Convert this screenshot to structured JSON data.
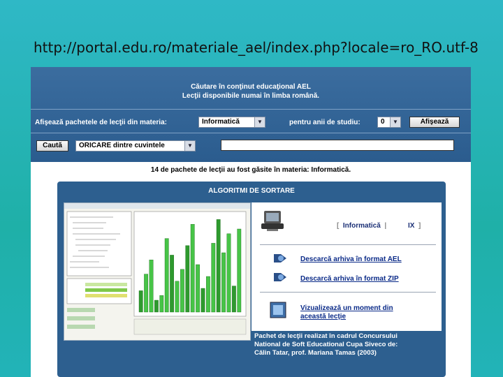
{
  "slide_url": "http://portal.edu.ro/materiale_ael/index.php?locale=ro_RO.utf-8",
  "search": {
    "title_line1": "Căutare în conţinut educaţional AEL",
    "title_line2": "Lecţii disponibile numai în limba română.",
    "subject_label": "Afişează pachetele de lecţii din materia:",
    "subject_value": "Informatică",
    "year_label": "pentru anii de studiu:",
    "year_value": "0",
    "show_button": "Afişează",
    "search_button": "Caută",
    "mode_value": "ORICARE dintre cuvintele",
    "query_value": ""
  },
  "results_text": "14 de pachete de lecţii au fost găsite în materia: Informatică.",
  "package": {
    "title": "ALGORITMI DE SORTARE",
    "subject": "Informatică",
    "grade": "IX",
    "link_ael": "Descarcă arhiva în format AEL",
    "link_zip": "Descarcă arhiva în format ZIP",
    "link_view_line1": "Vizualizează un moment din",
    "link_view_line2": "această lecţie",
    "description_line1": "Pachet de lecţii realizat în cadrul Concursului",
    "description_line2": "National de Soft Educational Cupa Siveco de:",
    "description_line3": "Călin Tatar, prof. Mariana Tamas (2003)"
  },
  "colors": {
    "slide_bg": "#22b3b8",
    "panel_bg": "#2d5f8f",
    "link": "#0a2a88"
  },
  "chart_data": {
    "type": "bar",
    "values": [
      18,
      32,
      44,
      10,
      14,
      62,
      48,
      26,
      36,
      56,
      74,
      40,
      20,
      30,
      58,
      78,
      50,
      66,
      22,
      70
    ]
  }
}
